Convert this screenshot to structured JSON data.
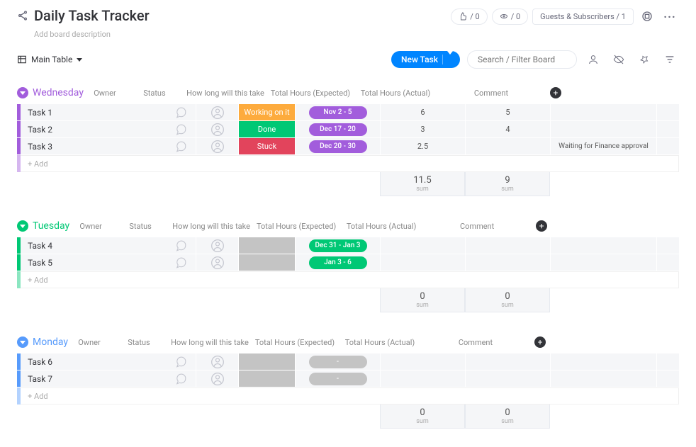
{
  "header": {
    "title": "Daily Task Tracker",
    "description": "Add board description",
    "view_name": "Main Table",
    "new_task": "New Task",
    "search_placeholder": "Search / Filter Board",
    "invite_label": "Guests & Subscribers / 1",
    "counter_a": "/ 0",
    "counter_b": "/ 0"
  },
  "columns": {
    "owner": "Owner",
    "status": "Status",
    "timeline": "How long will this take",
    "expected": "Total Hours (Expected)",
    "actual": "Total Hours (Actual)",
    "comment": "Comment"
  },
  "add_label": "+ Add",
  "sum_label": "sum",
  "groups": [
    {
      "name": "Wednesday",
      "color": "#a25ddc",
      "rows": [
        {
          "name": "Task 1",
          "status": "Working on it",
          "status_color": "#fdab3d",
          "timeline": "Nov 2 - 5",
          "timeline_color": "#a25ddc",
          "expected": "6",
          "actual": "5",
          "comment": ""
        },
        {
          "name": "Task 2",
          "status": "Done",
          "status_color": "#00c875",
          "timeline": "Dec 17 - 20",
          "timeline_color": "#a25ddc",
          "expected": "3",
          "actual": "4",
          "comment": ""
        },
        {
          "name": "Task 3",
          "status": "Stuck",
          "status_color": "#e2445c",
          "timeline": "Dec 20 - 30",
          "timeline_color": "#a25ddc",
          "expected": "2.5",
          "actual": "",
          "comment": "Waiting for Finance approval"
        }
      ],
      "sum_expected": "11.5",
      "sum_actual": "9"
    },
    {
      "name": "Tuesday",
      "color": "#00c875",
      "rows": [
        {
          "name": "Task 4",
          "status": "",
          "status_color": "#c4c4c4",
          "timeline": "Dec 31 - Jan 3",
          "timeline_color": "#00c875",
          "expected": "",
          "actual": "",
          "comment": ""
        },
        {
          "name": "Task 5",
          "status": "",
          "status_color": "#c4c4c4",
          "timeline": "Jan 3 - 6",
          "timeline_color": "#00c875",
          "expected": "",
          "actual": "",
          "comment": ""
        }
      ],
      "sum_expected": "0",
      "sum_actual": "0"
    },
    {
      "name": "Monday",
      "color": "#579bfc",
      "rows": [
        {
          "name": "Task 6",
          "status": "",
          "status_color": "#c4c4c4",
          "timeline": "-",
          "timeline_color": "#c4c4c4",
          "expected": "",
          "actual": "",
          "comment": ""
        },
        {
          "name": "Task 7",
          "status": "",
          "status_color": "#c4c4c4",
          "timeline": "-",
          "timeline_color": "#c4c4c4",
          "expected": "",
          "actual": "",
          "comment": ""
        }
      ],
      "sum_expected": "0",
      "sum_actual": "0"
    }
  ]
}
